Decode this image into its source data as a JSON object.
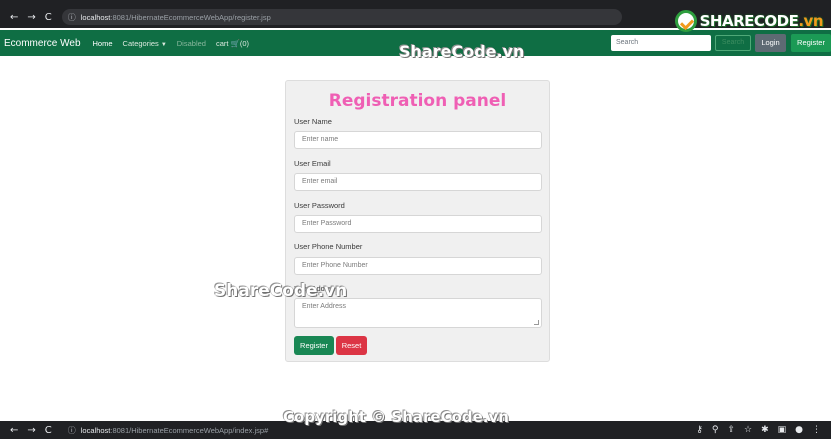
{
  "browser_top": {
    "url_host": "localhost",
    "url_rest": ":8081/HibernateEcommerceWebApp/register.jsp"
  },
  "browser_bottom": {
    "url_host": "localhost",
    "url_rest": ":8081/HibernateEcommerceWebApp/index.jsp#"
  },
  "logo": {
    "text_main": "SHARECODE",
    "text_accent": ".vn"
  },
  "navbar": {
    "brand": "Ecommerce Web",
    "home": "Home",
    "categories": "Categories",
    "disabled": "Disabled",
    "cart": "cart 🛒(0)",
    "search_placeholder": "Search",
    "search_button": "Search",
    "login": "Login",
    "register": "Register"
  },
  "form": {
    "title": "Registration panel",
    "fields": [
      {
        "label": "User Name",
        "placeholder": "Enter name"
      },
      {
        "label": "User Email",
        "placeholder": "Enter email"
      },
      {
        "label": "User Password",
        "placeholder": "Enter Password"
      },
      {
        "label": "User Phone Number",
        "placeholder": "Enter Phone Number"
      },
      {
        "label": "User Address",
        "placeholder": "Enter Address"
      }
    ],
    "register_button": "Register",
    "reset_button": "Reset"
  },
  "watermarks": {
    "top": "ShareCode.vn",
    "middle": "ShareCode.vn",
    "bottom": "Copyright © ShareCode.vn"
  },
  "colors": {
    "navbar": "#0f6e44",
    "title": "#ef5fb4",
    "register": "#198754",
    "reset": "#dc3545"
  }
}
